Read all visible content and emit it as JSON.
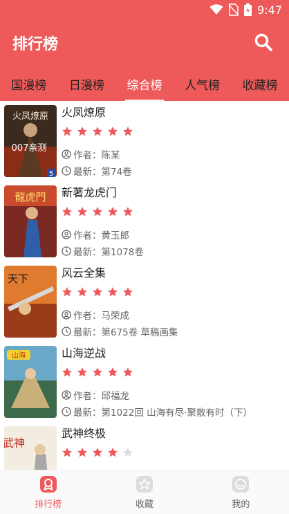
{
  "status": {
    "time": "9:47"
  },
  "app": {
    "title": "排行榜"
  },
  "tabs": [
    {
      "label": "国漫榜"
    },
    {
      "label": "日漫榜"
    },
    {
      "label": "综合榜",
      "active": true
    },
    {
      "label": "人气榜"
    },
    {
      "label": "收藏榜"
    }
  ],
  "labels": {
    "author_prefix": "作者：",
    "latest_prefix": "最新："
  },
  "comics": [
    {
      "title": "火凤燎原",
      "rating": 5,
      "author": "陈某",
      "latest": "第74卷",
      "cover_text": "火凤燎原",
      "cover_sub": "007亲测",
      "cover_badge": "5"
    },
    {
      "title": "新著龙虎门",
      "rating": 5,
      "author": "黄玉郎",
      "latest": "第1078卷",
      "cover_text": "龍虎門"
    },
    {
      "title": "风云全集",
      "rating": 5,
      "author": "马荣成",
      "latest": "第675卷 草稿画集",
      "cover_text": "天下"
    },
    {
      "title": "山海逆战",
      "rating": 5,
      "author": "邱福龙",
      "latest": "第1022回 山海有尽·聚散有时（下）",
      "cover_text": "山海"
    },
    {
      "title": "武神终极",
      "rating": 4,
      "author": "",
      "latest": "",
      "cover_text": "武神"
    }
  ],
  "bottom_nav": [
    {
      "label": "排行榜",
      "icon": "ranking-icon",
      "active": true
    },
    {
      "label": "收藏",
      "icon": "star-icon"
    },
    {
      "label": "我的",
      "icon": "profile-icon"
    }
  ],
  "colors": {
    "primary": "#ee5a5a",
    "star_on": "#ee5a5a",
    "star_off": "#dddddd"
  }
}
